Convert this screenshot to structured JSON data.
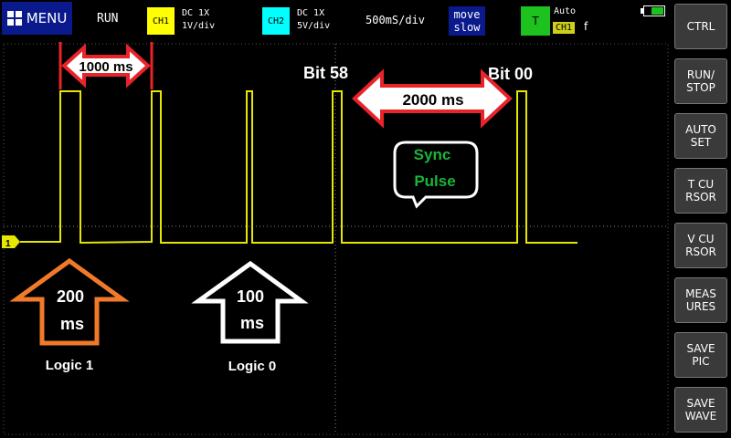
{
  "topbar": {
    "menu_label": "MENU",
    "run_state": "RUN",
    "ch1": {
      "tag": "CH1",
      "coupling": "DC  1X",
      "scale": "1V/div",
      "color": "#ffff00"
    },
    "ch2": {
      "tag": "CH2",
      "coupling": "DC  1X",
      "scale": "5V/div",
      "color": "#00ffff"
    },
    "timebase": "500mS/div",
    "move": {
      "line1": "move",
      "line2": "slow"
    },
    "trigger": {
      "tag": "T",
      "mode": "Auto",
      "source": "CH1",
      "edge": "f"
    },
    "battery_level": 0.6
  },
  "sidebar": {
    "items": [
      {
        "label": "CTRL"
      },
      {
        "label": "RUN/\nSTOP"
      },
      {
        "label": "AUTO\nSET"
      },
      {
        "label": "T CU\nRSOR"
      },
      {
        "label": "V CU\nRSOR"
      },
      {
        "label": "MEAS\nURES"
      },
      {
        "label": "SAVE\nPIC"
      },
      {
        "label": "SAVE\nWAVE"
      }
    ]
  },
  "annotations": {
    "span_1000": "1000 ms",
    "span_2000": "2000 ms",
    "bit58": "Bit 58",
    "bit00": "Bit 00",
    "sync_line1": "Sync",
    "sync_line2": "Pulse",
    "arrow1_value": "200",
    "arrow1_unit": "ms",
    "arrow1_label": "Logic 1",
    "arrow2_value": "100",
    "arrow2_unit": "ms",
    "arrow2_label": "Logic 0",
    "ch1_marker": "1"
  },
  "colors": {
    "trace": "#e6e600",
    "red": "#e8232a",
    "orange": "#f07a2a",
    "green": "#19b43a",
    "grid": "#777777"
  }
}
